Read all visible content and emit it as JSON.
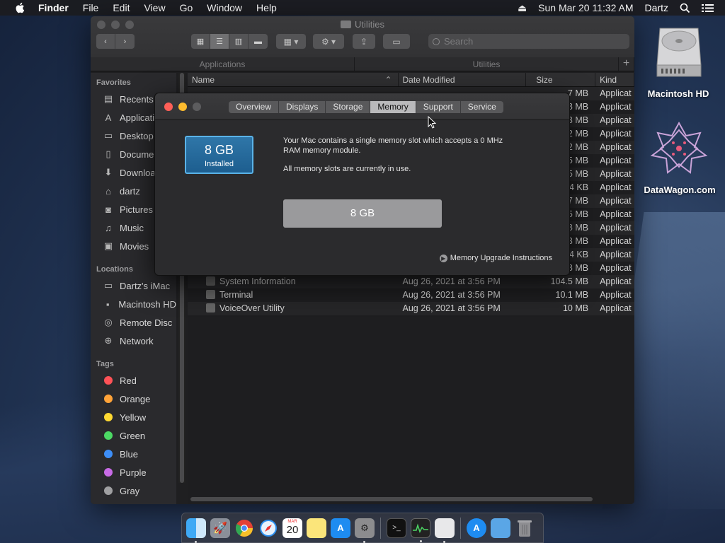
{
  "menubar": {
    "app": "Finder",
    "menus": [
      "File",
      "Edit",
      "View",
      "Go",
      "Window",
      "Help"
    ],
    "clock": "Sun Mar 20  11:32 AM",
    "user": "Dartz"
  },
  "finder": {
    "title": "Utilities",
    "search_placeholder": "Search",
    "path_tabs": [
      "Applications",
      "Utilities"
    ],
    "sidebar": {
      "favorites_label": "Favorites",
      "favorites": [
        "Recents",
        "Applications",
        "Desktop",
        "Documents",
        "Downloads",
        "dartz",
        "Pictures",
        "Music",
        "Movies"
      ],
      "locations_label": "Locations",
      "locations": [
        "Dartz's iMac",
        "Macintosh HD",
        "Remote Disc",
        "Network"
      ],
      "tags_label": "Tags",
      "tags": [
        {
          "name": "Red",
          "color": "#ff5257"
        },
        {
          "name": "Orange",
          "color": "#ffa338"
        },
        {
          "name": "Yellow",
          "color": "#ffd932"
        },
        {
          "name": "Green",
          "color": "#4cd964"
        },
        {
          "name": "Blue",
          "color": "#3d8ef7"
        },
        {
          "name": "Purple",
          "color": "#c86be6"
        },
        {
          "name": "Gray",
          "color": "#a0a0a2"
        }
      ]
    },
    "columns": {
      "name": "Name",
      "date": "Date Modified",
      "size": "Size",
      "kind": "Kind"
    },
    "partial_rows": [
      {
        "size": "7 MB",
        "kind": "Applicat"
      },
      {
        "size": "8 MB",
        "kind": "Applicat"
      },
      {
        "size": "3 MB",
        "kind": "Applicat"
      },
      {
        "size": "2 MB",
        "kind": "Applicat"
      },
      {
        "size": "2 MB",
        "kind": "Applicat"
      },
      {
        "size": "5 MB",
        "kind": "Applicat"
      },
      {
        "size": "5 MB",
        "kind": "Applicat"
      },
      {
        "size": "4 KB",
        "kind": "Applicat"
      },
      {
        "size": "7 MB",
        "kind": "Applicat"
      },
      {
        "size": "5 MB",
        "kind": "Applicat"
      },
      {
        "size": "8 MB",
        "kind": "Applicat"
      },
      {
        "size": "3 MB",
        "kind": "Applicat"
      },
      {
        "size": "4 KB",
        "kind": "Applicat"
      },
      {
        "size": "8 MB",
        "kind": "Applicat"
      }
    ],
    "rows": [
      {
        "name": "System Information",
        "date": "Aug 26, 2021 at 3:56 PM",
        "size": "104.5 MB",
        "kind": "Applicat"
      },
      {
        "name": "Terminal",
        "date": "Aug 26, 2021 at 3:56 PM",
        "size": "10.1 MB",
        "kind": "Applicat"
      },
      {
        "name": "VoiceOver Utility",
        "date": "Aug 26, 2021 at 3:56 PM",
        "size": "10 MB",
        "kind": "Applicat"
      }
    ]
  },
  "about": {
    "tabs": [
      "Overview",
      "Displays",
      "Storage",
      "Memory",
      "Support",
      "Service"
    ],
    "active_tab": "Memory",
    "installed_size": "8 GB",
    "installed_label": "Installed",
    "description_1": "Your Mac contains a single memory slot which accepts a 0 MHz RAM memory module.",
    "description_2": "All memory slots are currently in use.",
    "slot_label": "8 GB",
    "upgrade_link": "Memory Upgrade Instructions"
  },
  "desktop": {
    "icons": [
      {
        "label": "Macintosh HD",
        "icon": "hard-drive-icon"
      },
      {
        "label": "DataWagon.com",
        "icon": "datawagon-logo-icon"
      }
    ]
  },
  "dock": {
    "apps": [
      "finder",
      "launchpad",
      "chrome",
      "safari",
      "calendar",
      "notes",
      "app-store",
      "system-preferences",
      "terminal",
      "activity-monitor",
      "script-editor",
      "app-store-2",
      "downloads-folder",
      "trash"
    ],
    "calendar_day": "20",
    "calendar_month": "MAR"
  },
  "colors": {
    "accent": "#2f76a8",
    "tab_active": "#b9b9bb",
    "close": "#ff5f57",
    "minimize": "#febc2e"
  }
}
